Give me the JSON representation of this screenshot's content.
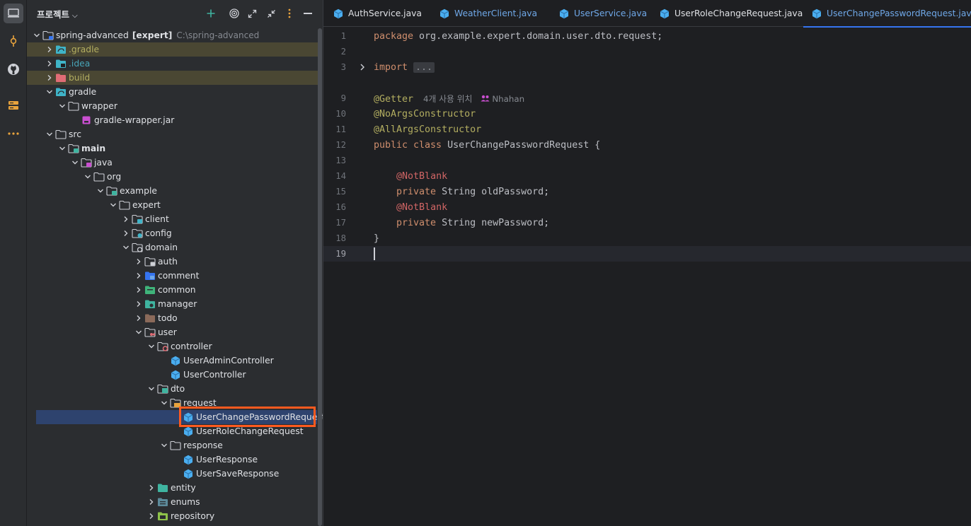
{
  "activity": {
    "items": [
      "project-icon",
      "commit-icon",
      "github-icon",
      "structure-icon",
      "more-icon"
    ]
  },
  "project": {
    "title": "프로젝트",
    "tree": [
      {
        "depth": 0,
        "expand": "open",
        "icon": "folder-module",
        "label": "spring-advanced",
        "bold_suffix": "[expert]",
        "path": "C:\\spring-advanced"
      },
      {
        "depth": 1,
        "expand": "closed",
        "icon": "folder-gradle",
        "label": ".gradle",
        "style": "yel",
        "hl": true
      },
      {
        "depth": 1,
        "expand": "closed",
        "icon": "folder-idea",
        "label": ".idea",
        "style": "teal"
      },
      {
        "depth": 1,
        "expand": "closed",
        "icon": "folder-build",
        "label": "build",
        "style": "yel",
        "hl": true
      },
      {
        "depth": 1,
        "expand": "open",
        "icon": "folder-gradle",
        "label": "gradle"
      },
      {
        "depth": 2,
        "expand": "open",
        "icon": "folder-plain",
        "label": "wrapper"
      },
      {
        "depth": 3,
        "expand": "none",
        "icon": "jar",
        "label": "gradle-wrapper.jar"
      },
      {
        "depth": 1,
        "expand": "open",
        "icon": "folder-plain",
        "label": "src"
      },
      {
        "depth": 2,
        "expand": "open",
        "icon": "folder-source-root",
        "label": "main",
        "bold": true
      },
      {
        "depth": 3,
        "expand": "open",
        "icon": "folder-java",
        "label": "java"
      },
      {
        "depth": 4,
        "expand": "open",
        "icon": "folder-plain",
        "label": "org"
      },
      {
        "depth": 5,
        "expand": "open",
        "icon": "folder-package",
        "label": "example"
      },
      {
        "depth": 6,
        "expand": "open",
        "icon": "folder-plain",
        "label": "expert"
      },
      {
        "depth": 7,
        "expand": "closed",
        "icon": "folder-client",
        "label": "client"
      },
      {
        "depth": 7,
        "expand": "closed",
        "icon": "folder-config",
        "label": "config"
      },
      {
        "depth": 7,
        "expand": "open",
        "icon": "folder-domain",
        "label": "domain"
      },
      {
        "depth": 8,
        "expand": "closed",
        "icon": "folder-auth",
        "label": "auth"
      },
      {
        "depth": 8,
        "expand": "closed",
        "icon": "folder-comment",
        "label": "comment"
      },
      {
        "depth": 8,
        "expand": "closed",
        "icon": "folder-common",
        "label": "common"
      },
      {
        "depth": 8,
        "expand": "closed",
        "icon": "folder-manager",
        "label": "manager"
      },
      {
        "depth": 8,
        "expand": "closed",
        "icon": "folder-todo",
        "label": "todo"
      },
      {
        "depth": 8,
        "expand": "open",
        "icon": "folder-user",
        "label": "user"
      },
      {
        "depth": 9,
        "expand": "open",
        "icon": "folder-controller",
        "label": "controller"
      },
      {
        "depth": 10,
        "expand": "none",
        "icon": "java-class",
        "label": "UserAdminController"
      },
      {
        "depth": 10,
        "expand": "none",
        "icon": "java-class",
        "label": "UserController"
      },
      {
        "depth": 9,
        "expand": "open",
        "icon": "folder-dto",
        "label": "dto"
      },
      {
        "depth": 10,
        "expand": "open",
        "icon": "folder-request",
        "label": "request"
      },
      {
        "depth": 11,
        "expand": "none",
        "icon": "java-class",
        "label": "UserChangePasswordRequest",
        "selected": true
      },
      {
        "depth": 11,
        "expand": "none",
        "icon": "java-class",
        "label": "UserRoleChangeRequest"
      },
      {
        "depth": 10,
        "expand": "open",
        "icon": "folder-plain",
        "label": "response"
      },
      {
        "depth": 11,
        "expand": "none",
        "icon": "java-class",
        "label": "UserResponse"
      },
      {
        "depth": 11,
        "expand": "none",
        "icon": "java-class",
        "label": "UserSaveResponse"
      },
      {
        "depth": 9,
        "expand": "closed",
        "icon": "folder-entity",
        "label": "entity"
      },
      {
        "depth": 9,
        "expand": "closed",
        "icon": "folder-enums",
        "label": "enums"
      },
      {
        "depth": 9,
        "expand": "closed",
        "icon": "folder-repository",
        "label": "repository"
      }
    ]
  },
  "editor": {
    "tabs": [
      {
        "label": "AuthService.java"
      },
      {
        "label": "WeatherClient.java",
        "faded": true
      },
      {
        "label": "UserService.java",
        "faded": true
      },
      {
        "label": "UserRoleChangeRequest.java"
      },
      {
        "label": "UserChangePasswordRequest.java",
        "active": true
      }
    ],
    "lines": [
      {
        "n": "1",
        "tokens": [
          [
            "kw",
            "package "
          ],
          [
            "",
            "org.example.expert.domain.user.dto.request;"
          ]
        ]
      },
      {
        "n": "2",
        "tokens": []
      },
      {
        "n": "3",
        "fold": true,
        "tokens": [
          [
            "kw",
            "import "
          ],
          [
            "dots",
            "..."
          ]
        ]
      },
      {
        "n": "",
        "tokens": []
      },
      {
        "n": "9",
        "tokens": [
          [
            "ann",
            "@Getter"
          ]
        ],
        "hint": "4개 사용 위치",
        "author": "Nhahan"
      },
      {
        "n": "10",
        "tokens": [
          [
            "ann",
            "@NoArgsConstructor"
          ]
        ]
      },
      {
        "n": "11",
        "tokens": [
          [
            "ann",
            "@AllArgsConstructor"
          ]
        ]
      },
      {
        "n": "12",
        "tokens": [
          [
            "kw",
            "public class "
          ],
          [
            "",
            "UserChangePasswordRequest {"
          ]
        ]
      },
      {
        "n": "13",
        "tokens": []
      },
      {
        "n": "14",
        "tokens": [
          [
            "",
            "    "
          ],
          [
            "ann2",
            "@NotBlank"
          ]
        ]
      },
      {
        "n": "15",
        "tokens": [
          [
            "kw",
            "    private "
          ],
          [
            "",
            "String oldPassword;"
          ]
        ]
      },
      {
        "n": "16",
        "tokens": [
          [
            "",
            "    "
          ],
          [
            "ann2",
            "@NotBlank"
          ]
        ]
      },
      {
        "n": "17",
        "tokens": [
          [
            "kw",
            "    private "
          ],
          [
            "",
            "String newPassword;"
          ]
        ]
      },
      {
        "n": "18",
        "tokens": [
          [
            "",
            "}"
          ]
        ]
      },
      {
        "n": "19",
        "tokens": [],
        "current": true
      }
    ]
  }
}
